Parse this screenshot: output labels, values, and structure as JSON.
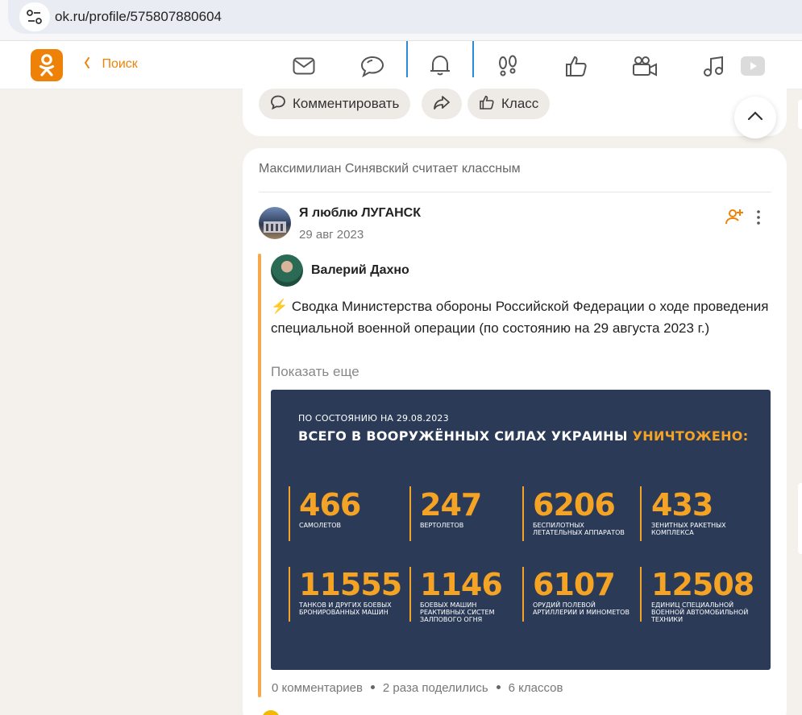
{
  "browser": {
    "url": "ok.ru/profile/575807880604",
    "site_info_icon": "tune-icon"
  },
  "topnav": {
    "logo_icon": "odnoklassniki-logo",
    "back_label": "Поиск",
    "icons": [
      "mail-icon",
      "chat-icon",
      "bell-icon",
      "footprints-icon",
      "like-icon",
      "video-camera-icon",
      "music-icon",
      "video-play-icon"
    ],
    "active": "bell-icon"
  },
  "prev_post": {
    "comment_label": "Комментировать",
    "class_label": "Класс"
  },
  "post": {
    "activity": "Максимилиан Синявский считает классным",
    "group_name": "Я люблю ЛУГАНСК",
    "date": "29 авг 2023",
    "author": "Валерий Дахно",
    "text_bolt": "⚡",
    "text": "Сводка Министерства обороны Российской Федерации о ходе проведения специальной военной операции (по состоянию на 29 августа 2023 г.)",
    "show_more": "Показать еще",
    "stats": {
      "comments": "0 комментариев",
      "shares": "2 раза поделились",
      "classes": "6 классов"
    }
  },
  "infographic": {
    "subtitle": "ПО СОСТОЯНИЮ НА 29.08.2023",
    "title_main": "ВСЕГО В ВООРУЖЁННЫХ СИЛАХ УКРАИНЫ",
    "title_highlight": "УНИЧТОЖЕНО:",
    "accent": "#f5a325",
    "background": "#2b3b57",
    "items": [
      {
        "num": "466",
        "label": "САМОЛЕТОВ"
      },
      {
        "num": "247",
        "label": "ВЕРТОЛЕТОВ"
      },
      {
        "num": "6206",
        "label": "БЕСПИЛОТНЫХ ЛЕТАТЕЛЬНЫХ АППАРАТОВ"
      },
      {
        "num": "433",
        "label": "ЗЕНИТНЫХ РАКЕТНЫХ КОМПЛЕКСА"
      },
      {
        "num": "11555",
        "label": "ТАНКОВ И ДРУГИХ БОЕВЫХ БРОНИРОВАННЫХ МАШИН"
      },
      {
        "num": "1146",
        "label": "БОЕВЫХ МАШИН РЕАКТИВНЫХ СИСТЕМ ЗАЛПОВОГО ОГНЯ"
      },
      {
        "num": "6107",
        "label": "ОРУДИЙ ПОЛЕВОЙ АРТИЛЛЕРИИ И МИНОМЕТОВ"
      },
      {
        "num": "12508",
        "label": "ЕДИНИЦ СПЕЦИАЛЬНОЙ ВОЕННОЙ АВТОМОБИЛЬНОЙ ТЕХНИКИ"
      }
    ]
  },
  "colors": {
    "brand": "#ee8208",
    "active_tab": "#2a8bd6",
    "page_bg": "#f4f1ed"
  }
}
